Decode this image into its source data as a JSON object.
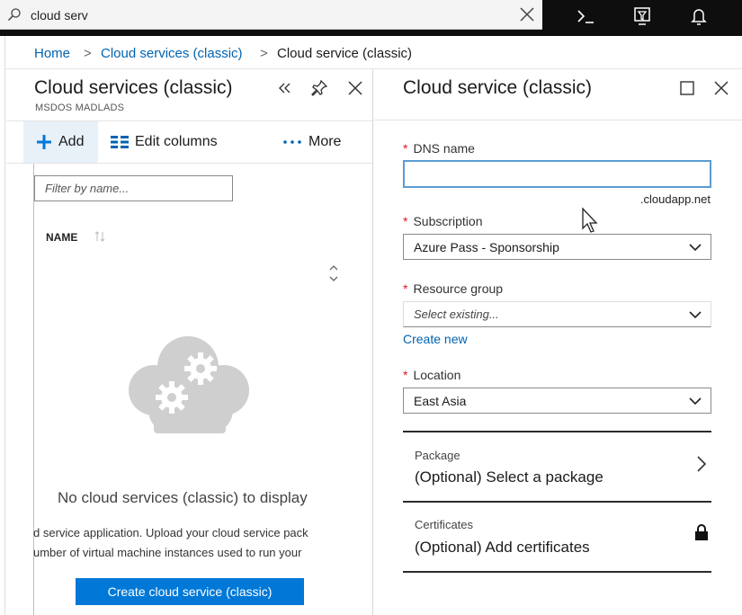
{
  "topbar": {
    "search_value": "cloud serv",
    "icons": [
      "search-icon",
      "close-icon",
      "cloud-shell-icon",
      "directory-filter-icon",
      "notifications-icon"
    ]
  },
  "breadcrumb": {
    "home": "Home",
    "sep": ">",
    "cloud_services": "Cloud services (classic)",
    "current": "Cloud service (classic)"
  },
  "left_blade": {
    "title": "Cloud services (classic)",
    "subtitle": "MSDOS MADLADS",
    "commands": {
      "add": "Add",
      "edit_columns": "Edit columns",
      "more": "More"
    },
    "filter_placeholder": "Filter by name...",
    "column_header": "NAME",
    "empty_title": "No cloud services (classic) to display",
    "empty_line_1": "d service application. Upload your cloud service pack",
    "empty_line_2": "umber of virtual machine instances used to run your",
    "create_button": "Create cloud service (classic)"
  },
  "right_blade": {
    "title": "Cloud service (classic)",
    "dns": {
      "label": "DNS name",
      "value": "",
      "suffix": ".cloudapp.net"
    },
    "subscription": {
      "label": "Subscription",
      "value": "Azure Pass - Sponsorship"
    },
    "resource_group": {
      "label": "Resource group",
      "placeholder": "Select existing...",
      "create_new": "Create new"
    },
    "location": {
      "label": "Location",
      "value": "East Asia"
    },
    "package": {
      "label": "Package",
      "value": "(Optional) Select a package"
    },
    "certificates": {
      "label": "Certificates",
      "value": "(Optional) Add certificates"
    }
  },
  "colors": {
    "accent": "#0078d7",
    "link": "#0063b1",
    "required": "#e81123",
    "topbar": "#0e0e0e"
  }
}
